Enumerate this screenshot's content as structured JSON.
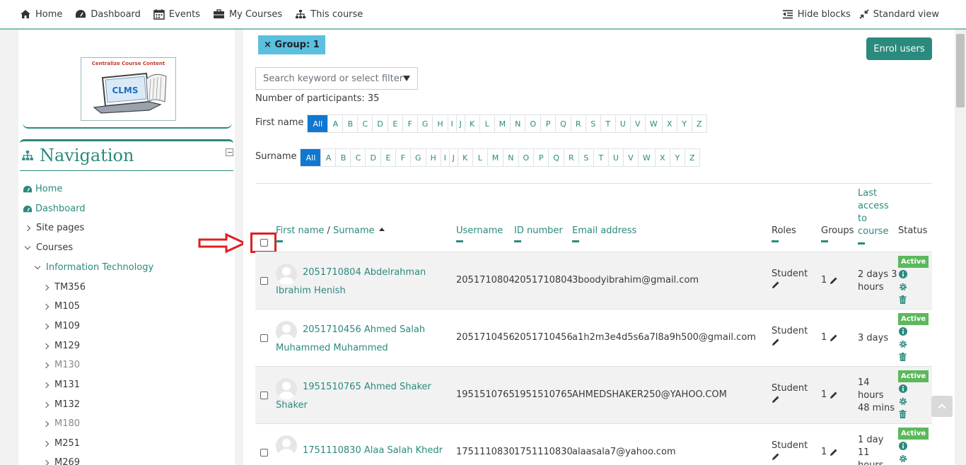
{
  "topnav": {
    "home": "Home",
    "dashboard": "Dashboard",
    "events": "Events",
    "my_courses": "My Courses",
    "this_course": "This course",
    "hide_blocks": "Hide blocks",
    "standard_view": "Standard view"
  },
  "logo": {
    "text": "Centralize Course Content",
    "screen_text": "CLMS"
  },
  "navigation": {
    "title": "Navigation",
    "items": [
      {
        "label": "Home"
      },
      {
        "label": "Dashboard"
      },
      {
        "label": "Site pages"
      },
      {
        "label": "Courses"
      },
      {
        "label": "Information Technology"
      },
      {
        "label": "TM356"
      },
      {
        "label": "M105"
      },
      {
        "label": "M109"
      },
      {
        "label": "M129"
      },
      {
        "label": "M130"
      },
      {
        "label": "M131"
      },
      {
        "label": "M132"
      },
      {
        "label": "M180"
      },
      {
        "label": "M251"
      },
      {
        "label": "M269"
      }
    ]
  },
  "filters": {
    "group_tag": "× Group: 1",
    "enrol_button": "Enrol users",
    "search_placeholder": "Search keyword or select filter",
    "participants_count": "Number of participants: 35"
  },
  "initials": {
    "first_name_label": "First name",
    "surname_label": "Surname",
    "all_label": "All",
    "letters": [
      "A",
      "B",
      "C",
      "D",
      "E",
      "F",
      "G",
      "H",
      "I",
      "J",
      "K",
      "L",
      "M",
      "N",
      "O",
      "P",
      "Q",
      "R",
      "S",
      "T",
      "U",
      "V",
      "W",
      "X",
      "Y",
      "Z"
    ]
  },
  "table": {
    "headers": {
      "first_name": "First name",
      "separator": " / ",
      "surname": "Surname",
      "username": "Username",
      "id_number": "ID number",
      "email": "Email address",
      "roles": "Roles",
      "groups": "Groups",
      "last_access_1": "Last",
      "last_access_2": "access",
      "last_access_3": "to",
      "last_access_4": "course",
      "status": "Status"
    },
    "rows": [
      {
        "name_line1": "2051710804 Abdelrahman",
        "name_line2": "Ibrahim Henish",
        "username": "2051710804",
        "id_number": "2051710804",
        "email": "3boodyibrahim@gmail.com",
        "role": "Student",
        "groups": "1",
        "access_lines": [
          "2 days 3",
          "hours"
        ],
        "status": "Active"
      },
      {
        "name_line1": "2051710456 Ahmed Salah",
        "name_line2": "Muhammed Muhammed",
        "username": "2051710456",
        "id_number": "2051710456",
        "email": "a1h2m3e4d5s6a7l8a9h500@gmail.com",
        "role": "Student",
        "groups": "1",
        "access_lines": [
          "3 days"
        ],
        "status": "Active"
      },
      {
        "name_line1": "1951510765 Ahmed Shaker",
        "name_line2": "Shaker",
        "username": "1951510765",
        "id_number": "1951510765",
        "email": "AHMEDSHAKER250@YAHOO.COM",
        "role": "Student",
        "groups": "1",
        "access_lines": [
          "14",
          "hours",
          "48 mins"
        ],
        "status": "Active"
      },
      {
        "name_line1": "1751110830 Alaa Salah Khedr",
        "name_line2": "",
        "username": "1751110830",
        "id_number": "1751110830",
        "email": "alaasala7@yahoo.com",
        "role": "Student",
        "groups": "1",
        "access_lines": [
          "1 day",
          "11",
          "hours"
        ],
        "status": "Active"
      }
    ]
  },
  "colors": {
    "accent": "#2b8a7e",
    "active_badge": "#5cb85c",
    "group_tag": "#5bc0de",
    "highlight": "#e02020"
  }
}
